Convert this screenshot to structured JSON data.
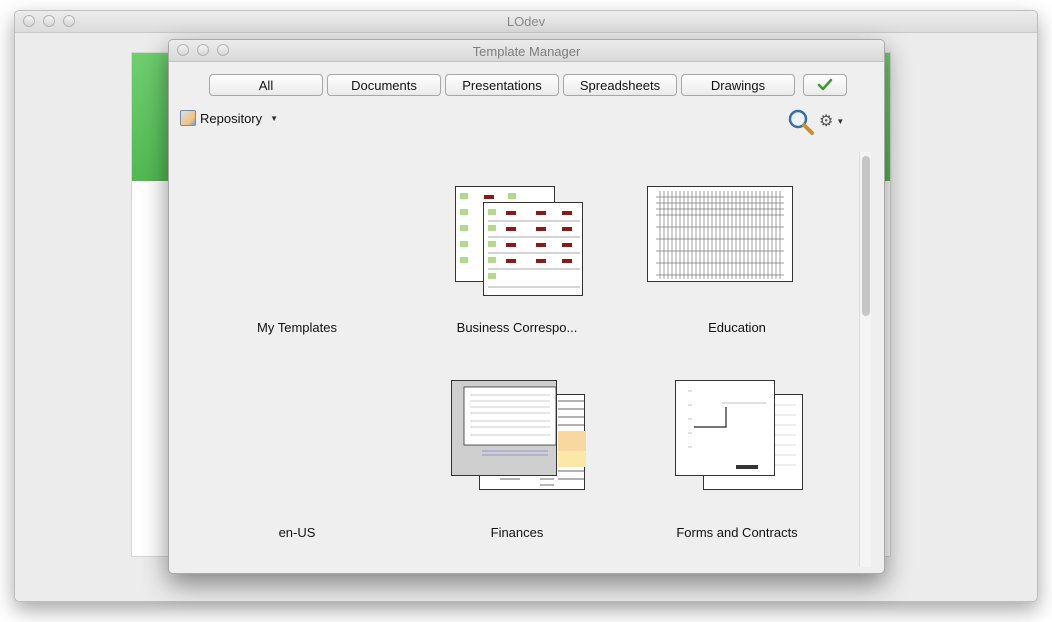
{
  "outer_window": {
    "title": "LOdev"
  },
  "dialog": {
    "title": "Template Manager",
    "filters": [
      "All",
      "Documents",
      "Presentations",
      "Spreadsheets",
      "Drawings"
    ],
    "ok_icon": "checkmark-icon",
    "repository_label": "Repository",
    "search_icon": "search-icon",
    "settings_icon": "gear-icon"
  },
  "folders": [
    {
      "label": "My Templates"
    },
    {
      "label": "Business Correspo..."
    },
    {
      "label": "Education"
    },
    {
      "label": "en-US"
    },
    {
      "label": "Finances"
    },
    {
      "label": "Forms and Contracts"
    }
  ],
  "colors": {
    "accent_green": "#52b852",
    "checkmark": "#3a9a2a"
  }
}
